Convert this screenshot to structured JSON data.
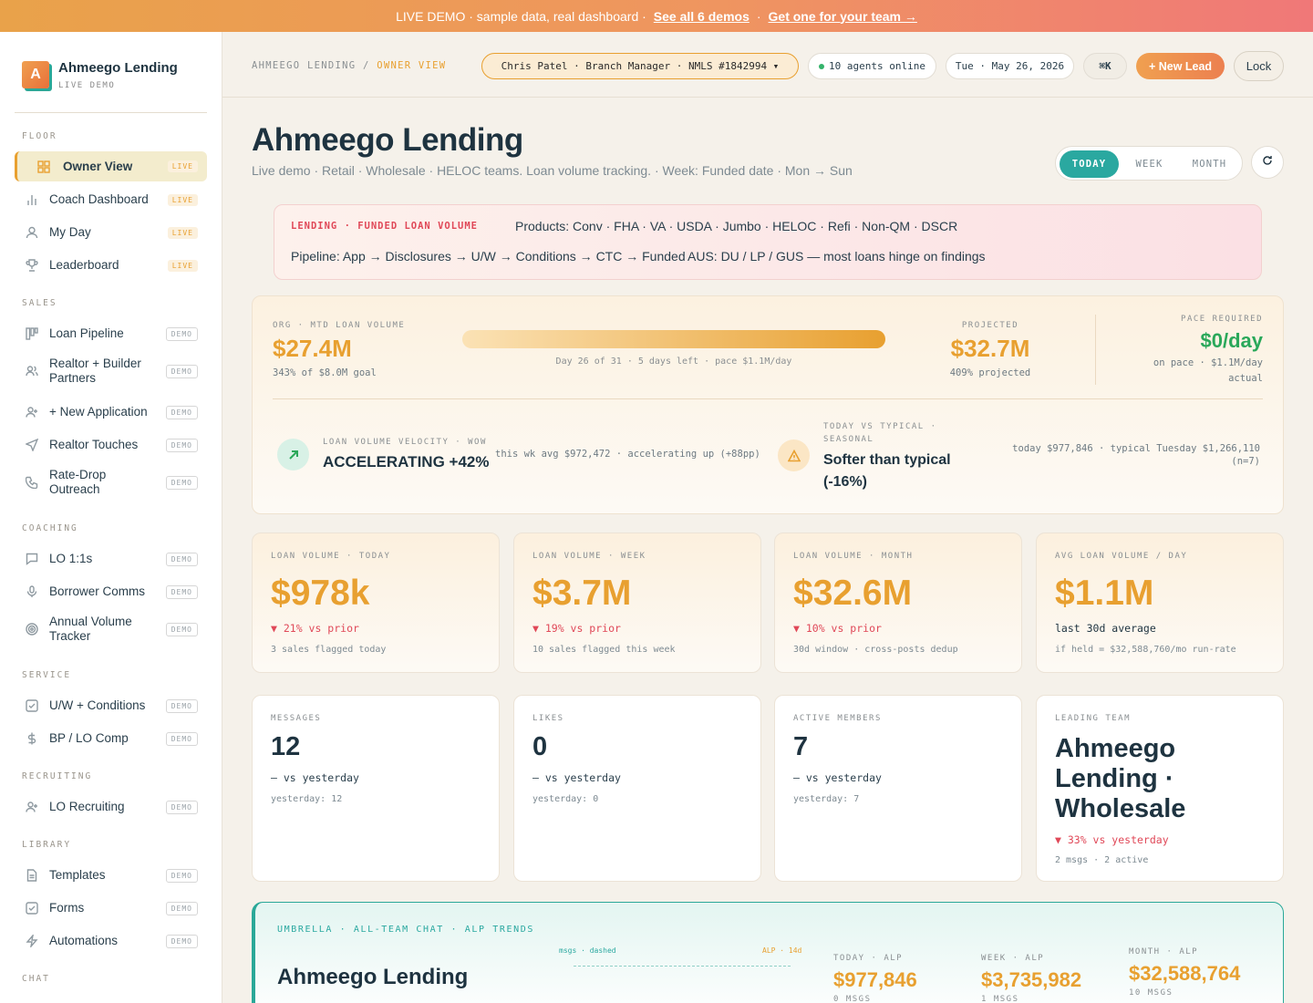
{
  "banner": {
    "text": "LIVE DEMO · sample data, real dashboard ·",
    "link1": "See all 6 demos",
    "sep": "·",
    "link2": "Get one for your team →"
  },
  "brand": {
    "logo_letter": "A",
    "name": "Ahmeego Lending",
    "sub": "LIVE DEMO"
  },
  "sidebar": {
    "sections": {
      "floor": "FLOOR",
      "sales": "SALES",
      "coaching": "COACHING",
      "service": "SERVICE",
      "recruiting": "RECRUITING",
      "library": "LIBRARY",
      "chat": "CHAT"
    },
    "items": [
      {
        "label": "Owner View",
        "badge": "LIVE",
        "icon": "grid-icon"
      },
      {
        "label": "Coach Dashboard",
        "badge": "LIVE",
        "icon": "bar-chart-icon"
      },
      {
        "label": "My Day",
        "badge": "LIVE",
        "icon": "user-icon"
      },
      {
        "label": "Leaderboard",
        "badge": "LIVE",
        "icon": "trophy-icon"
      },
      {
        "label": "Loan Pipeline",
        "badge": "DEMO",
        "icon": "kanban-icon"
      },
      {
        "label": "Realtor + Builder Partners",
        "badge": "DEMO",
        "icon": "users-icon"
      },
      {
        "label": "+ New Application",
        "badge": "DEMO",
        "icon": "user-plus-icon"
      },
      {
        "label": "Realtor Touches",
        "badge": "DEMO",
        "icon": "send-icon"
      },
      {
        "label": "Rate-Drop Outreach",
        "badge": "DEMO",
        "icon": "phone-icon"
      },
      {
        "label": "LO 1:1s",
        "badge": "DEMO",
        "icon": "message-icon"
      },
      {
        "label": "Borrower Comms",
        "badge": "DEMO",
        "icon": "mic-icon"
      },
      {
        "label": "Annual Volume Tracker",
        "badge": "DEMO",
        "icon": "target-icon"
      },
      {
        "label": "U/W + Conditions",
        "badge": "DEMO",
        "icon": "checkbox-icon"
      },
      {
        "label": "BP / LO Comp",
        "badge": "DEMO",
        "icon": "dollar-icon"
      },
      {
        "label": "LO Recruiting",
        "badge": "DEMO",
        "icon": "user-plus-icon"
      },
      {
        "label": "Templates",
        "badge": "DEMO",
        "icon": "document-icon"
      },
      {
        "label": "Forms",
        "badge": "DEMO",
        "icon": "checkbox-icon"
      },
      {
        "label": "Automations",
        "badge": "DEMO",
        "icon": "lightning-icon"
      }
    ]
  },
  "topbar": {
    "crumb_root": "AHMEEGO LENDING",
    "crumb_sep": "/",
    "crumb_current": "OWNER VIEW",
    "user": "Chris Patel · Branch Manager · NMLS #1842994 ▾",
    "agents": "10 agents online",
    "date": "Tue · May 26, 2026",
    "shortcut": "⌘K",
    "new_lead": "+ New Lead",
    "lock": "Lock"
  },
  "page": {
    "title": "Ahmeego Lending",
    "subtitle": "Live demo · Retail · Wholesale · HELOC teams. Loan volume tracking. · Week: Funded date · Mon → Sun",
    "periods": [
      "TODAY",
      "WEEK",
      "MONTH"
    ],
    "selected_period": "TODAY"
  },
  "info": {
    "tag": "LENDING · FUNDED LOAN VOLUME",
    "products": "Products: Conv · FHA · VA · USDA · Jumbo · HELOC · Refi · Non-QM · DSCR",
    "pipeline": "Pipeline: App → Disclosures → U/W → Conditions → CTC → Funded",
    "aus": "AUS: DU / LP / GUS — most loans hinge on findings"
  },
  "mtd": {
    "label": "ORG · MTD LOAN VOLUME",
    "value": "$27.4M",
    "goal": "343% of $8.0M goal",
    "progress_pct": 100,
    "progress_text": "Day 26 of 31 · 5 days left · pace $1.1M/day",
    "proj_label": "PROJECTED",
    "proj_value": "$32.7M",
    "proj_sub": "409% projected",
    "pace_label": "PACE REQUIRED",
    "pace_value": "$0/day",
    "pace_sub": "on pace · $1.1M/day actual"
  },
  "velocity": {
    "label": "LOAN VOLUME VELOCITY · WOW",
    "value": "ACCELERATING +42%",
    "note": "this wk avg $972,472 · accelerating up (+88pp)"
  },
  "seasonal": {
    "label": "TODAY VS TYPICAL · SEASONAL",
    "value": "Softer than typical (-16%)",
    "note": "today $977,846 · typical Tuesday $1,266,110 (n=7)"
  },
  "kpis": [
    {
      "label": "LOAN VOLUME · TODAY",
      "value": "$978k",
      "delta": "▼ 21% vs prior",
      "note": "3 sales flagged today"
    },
    {
      "label": "LOAN VOLUME · WEEK",
      "value": "$3.7M",
      "delta": "▼ 19% vs prior",
      "note": "10 sales flagged this week"
    },
    {
      "label": "LOAN VOLUME · MONTH",
      "value": "$32.6M",
      "delta": "▼ 10% vs prior",
      "note": "30d window · cross-posts dedup"
    },
    {
      "label": "AVG LOAN VOLUME / DAY",
      "value": "$1.1M",
      "delta": "last 30d average",
      "note": "if held = $32,588,760/mo run-rate"
    }
  ],
  "stats": [
    {
      "label": "MESSAGES",
      "value": "12",
      "delta": "— vs yesterday",
      "note": "yesterday: 12"
    },
    {
      "label": "LIKES",
      "value": "0",
      "delta": "— vs yesterday",
      "note": "yesterday: 0"
    },
    {
      "label": "ACTIVE MEMBERS",
      "value": "7",
      "delta": "— vs yesterday",
      "note": "yesterday: 7"
    }
  ],
  "leading": {
    "label": "LEADING TEAM",
    "value": "Ahmeego Lending · Wholesale",
    "delta": "▼ 33% vs yesterday",
    "note": "2 msgs · 2 active"
  },
  "umbrella": {
    "tag": "UMBRELLA · ALL-TEAM CHAT · ALP TRENDS",
    "title": "Ahmeego Lending",
    "legend_left": "msgs · dashed",
    "legend_right": "ALP · 14d",
    "today_label": "TODAY · ALP",
    "today_value": "$977,846",
    "today_sub": "0 MSGS",
    "week_label": "WEEK · ALP",
    "week_value": "$3,735,982",
    "week_sub": "1 MSGS",
    "month_label": "MONTH · ALP",
    "month_value": "$32,588,764",
    "month_sub": "10 MSGS"
  },
  "colors": {
    "accent": "#e8a030",
    "teal": "#2aa8a0",
    "down": "#e04858",
    "up": "#2aa85a"
  }
}
